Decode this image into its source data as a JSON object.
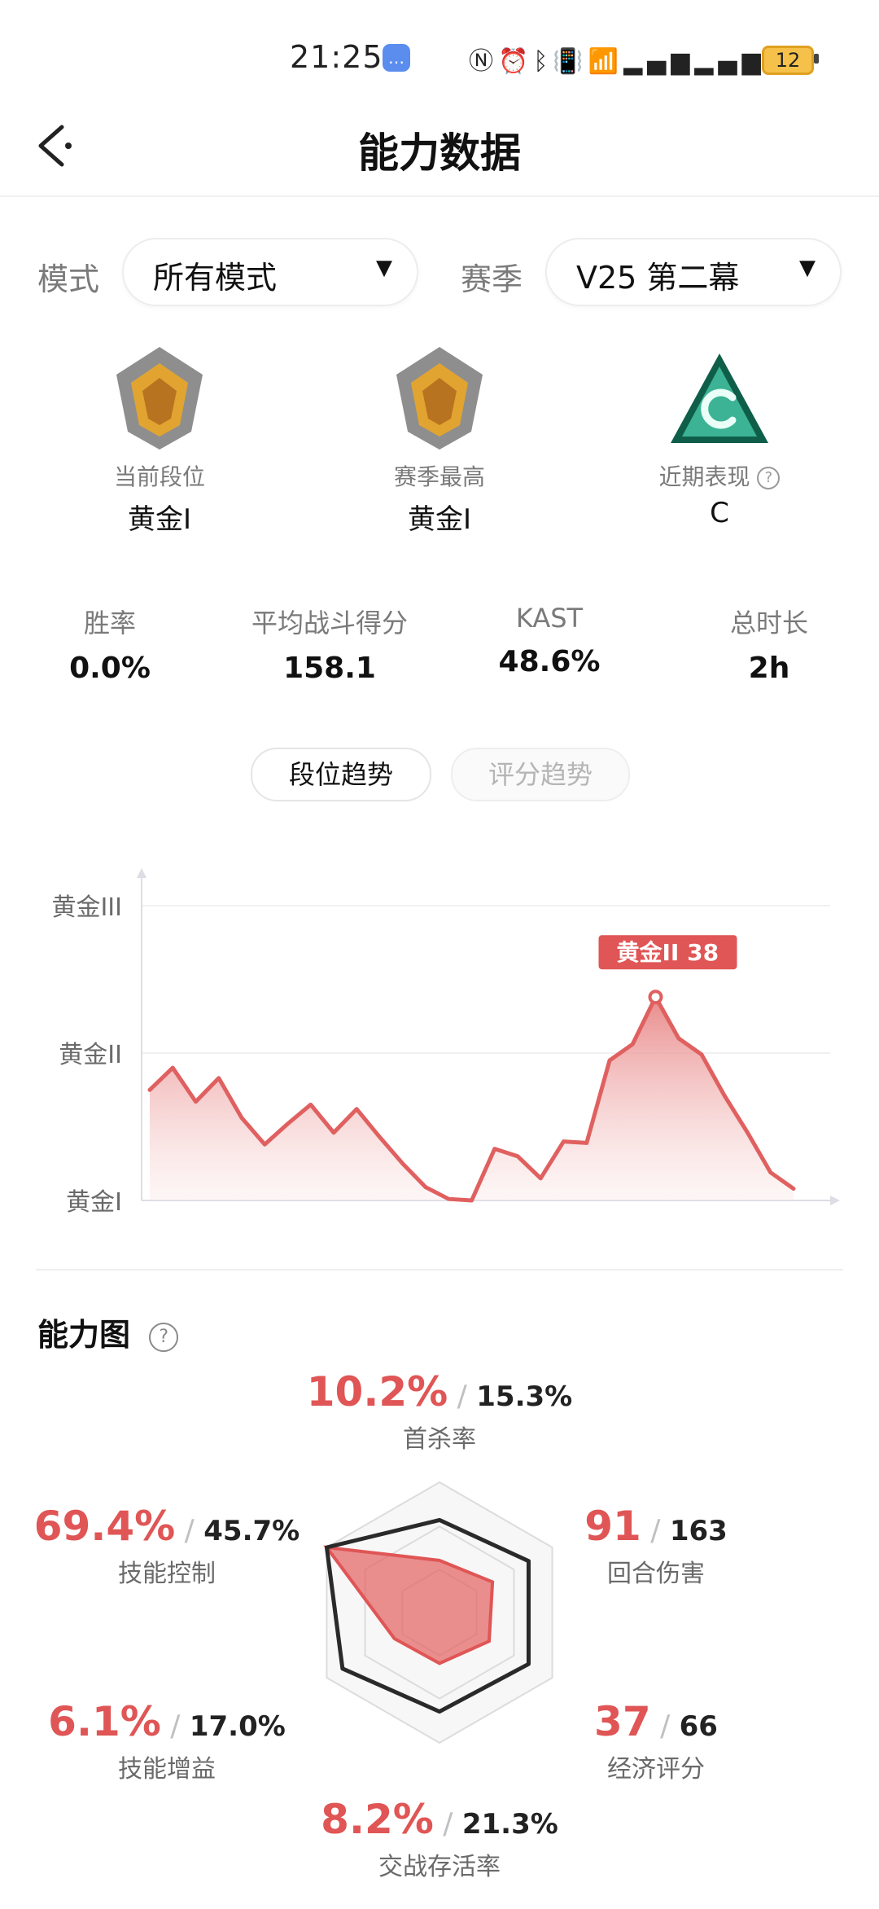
{
  "status_bar": {
    "time": "21:25",
    "icons": [
      "nfc-icon",
      "alarm-icon",
      "bluetooth-icon",
      "vibrate-icon",
      "wifi-icon",
      "signal-4g-icon",
      "signal-5g-icon"
    ],
    "battery": "12"
  },
  "header": {
    "title": "能力数据",
    "back_icon": "back-arrow-icon"
  },
  "filters": {
    "mode_label": "模式",
    "mode_value": "所有模式",
    "season_label": "赛季",
    "season_value": "V25 第二幕"
  },
  "badges": [
    {
      "label": "当前段位",
      "value": "黄金I"
    },
    {
      "label": "赛季最高",
      "value": "黄金I"
    },
    {
      "label": "近期表现",
      "value": "C"
    }
  ],
  "stats": [
    {
      "label": "胜率",
      "value": "0.0%"
    },
    {
      "label": "平均战斗得分",
      "value": "158.1"
    },
    {
      "label": "KAST",
      "value": "48.6%"
    },
    {
      "label": "总时长",
      "value": "2h"
    }
  ],
  "tabs": {
    "rank_trend": "段位趋势",
    "score_trend": "评分趋势"
  },
  "chart_data": {
    "type": "area",
    "y_tick_labels": [
      "黄金I",
      "黄金II",
      "黄金III"
    ],
    "highlight_label": "黄金II 38",
    "y_range": [
      0,
      2
    ],
    "values": [
      0.75,
      0.9,
      0.67,
      0.83,
      0.56,
      0.38,
      0.52,
      0.65,
      0.46,
      0.62,
      0.43,
      0.25,
      0.09,
      0.01,
      0.0,
      0.35,
      0.3,
      0.15,
      0.4,
      0.39,
      0.95,
      1.06,
      1.38,
      1.1,
      0.99,
      0.71,
      0.46,
      0.19,
      0.08
    ],
    "highlight_index": 22,
    "colors": {
      "line": "#e06060",
      "fill_top": "#e88585",
      "fill_bottom": "#fbe6e6"
    }
  },
  "ability": {
    "title": "能力图",
    "metrics": [
      {
        "id": "first_kill",
        "value": "10.2%",
        "avg": "15.3%",
        "label": "首杀率"
      },
      {
        "id": "round_damage",
        "value": "91",
        "avg": "163",
        "label": "回合伤害"
      },
      {
        "id": "economy",
        "value": "37",
        "avg": "66",
        "label": "经济评分"
      },
      {
        "id": "survival",
        "value": "8.2%",
        "avg": "21.3%",
        "label": "交战存活率"
      },
      {
        "id": "skill_gain",
        "value": "6.1%",
        "avg": "17.0%",
        "label": "技能增益"
      },
      {
        "id": "skill_control",
        "value": "69.4%",
        "avg": "45.7%",
        "label": "技能控制"
      }
    ],
    "radar_player": [
      0.4,
      0.47,
      0.44,
      0.39,
      0.4,
      1.0
    ],
    "radar_avg": [
      0.71,
      0.79,
      0.79,
      0.76,
      0.86,
      1.0
    ],
    "colors": {
      "player": "#e05555",
      "average": "#2a2a2a"
    }
  }
}
